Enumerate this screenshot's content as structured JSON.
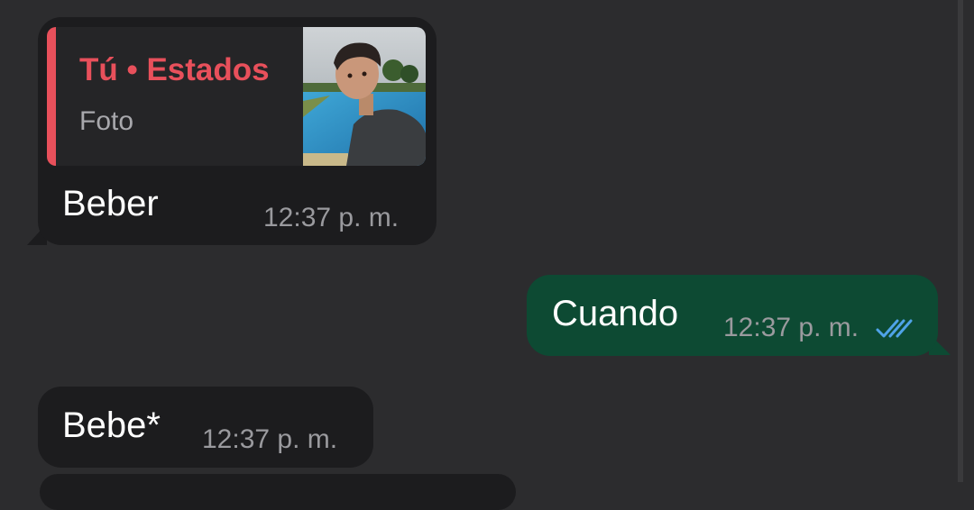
{
  "messages": [
    {
      "direction": "incoming",
      "reply": {
        "author": "Tú • Estados",
        "type": "Foto"
      },
      "text": "Beber",
      "time": "12:37 p. m."
    },
    {
      "direction": "outgoing",
      "text": "Cuando",
      "time": "12:37 p. m.",
      "status": "read-double-check-icon"
    },
    {
      "direction": "incoming",
      "text": "Bebe*",
      "time": "12:37 p. m."
    }
  ],
  "colors": {
    "background": "#2c2c2e",
    "incoming_bubble": "#1c1c1e",
    "outgoing_bubble": "#0d4a33",
    "quote_accent": "#e8505b",
    "read_check": "#4fa3e8"
  }
}
